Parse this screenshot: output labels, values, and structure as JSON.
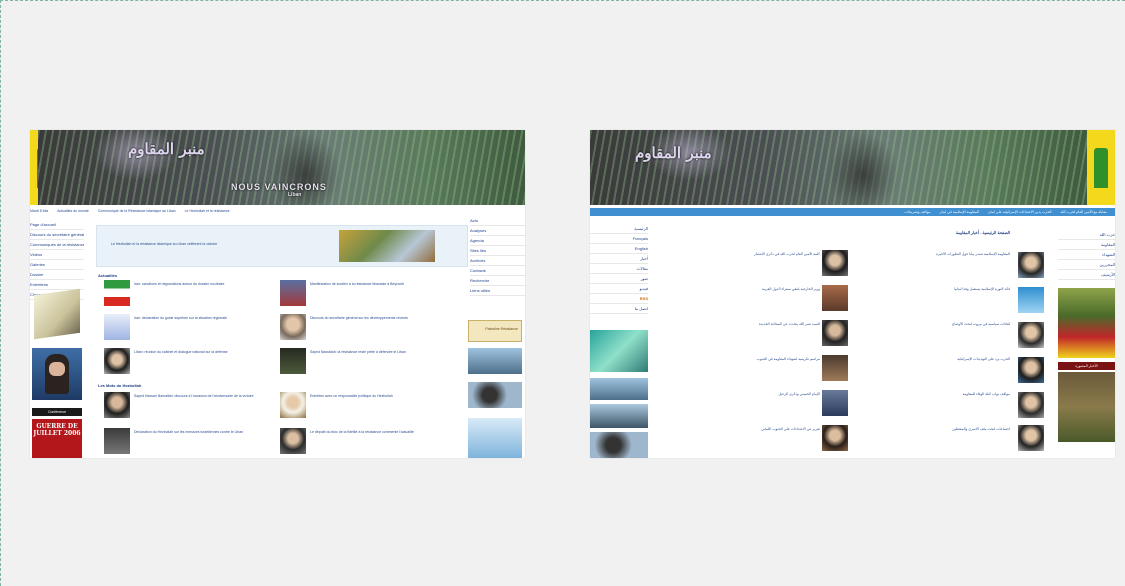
{
  "left_site": {
    "banner_title_ar": "منبر المقاوم",
    "banner_title_fr": "NOUS VAINCRONS",
    "banner_subtitle": "Liban",
    "link_bar": [
      "Mardi 8 Mai",
      "Actualités du monde",
      "Communiqué de la Résistance islamique au Liban",
      "Le Hezbollah et la résistance"
    ],
    "left_nav": [
      "Page d'accueil",
      "Discours du secrétaire général",
      "Communiqués de la résistance",
      "Vidéos",
      "Galeries",
      "Dossier",
      "Entretiens",
      "Chronologie"
    ],
    "left_ad_label": "Conférence",
    "left_box_caption": "GUERRE DE JUILLET 2006",
    "headline_text": "Le Hezbollah et la résistance islamique au Liban célèbrent la victoire",
    "section_actualites": "Actualités",
    "section_les_mots": "Les Mots du Hezbollah",
    "news_items": [
      "Iran: sanctions et négociations autour du dossier nucléaire",
      "Manifestation de soutien à la résistance libanaise à Beyrouth",
      "Iran: déclaration du guide suprême sur la situation régionale",
      "Discours du secrétaire général sur les développements récents",
      "Liban: réunion du cabinet et dialogue national sur la défense",
      "Sayed Nasrallah: la résistance reste prête à défendre le Liban"
    ],
    "mots_items": [
      "Sayed Hassan Nasrallah: discours à l'occasion de l'anniversaire de la victoire",
      "Entretien avec un responsable politique du Hezbollah",
      "Déclaration du Hezbollah sur les menaces israéliennes contre le Liban",
      "Le député du bloc de la fidélité à la résistance commente l'actualité"
    ],
    "right_nav": [
      "Actu",
      "Analyses",
      "Agenda",
      "Sites liés",
      "Archives",
      "Contacts",
      "Recherche",
      "Liens utiles"
    ],
    "right_ad_label": "Palestine Résistance"
  },
  "right_site": {
    "banner_title_ar": "منبر المقاوم",
    "link_bar": [
      "مقابلة مع الأمين العام لحزب الله",
      "الحزب يدين الاعتداءات الإسرائيلية على لبنان",
      "المقاومة الإسلامية في لبنان",
      "مواقف وتصريحات"
    ],
    "section_title": "الصفحة الرئيسية - أخبار المقاومة",
    "left_nav": [
      "الرئيسية",
      "Français",
      "English",
      "أخبار",
      "مقالات",
      "صور",
      "فيديو",
      "RSS",
      "اتصل بنا"
    ],
    "news_items": [
      "كلمة الأمين العام لحزب الله في ذكرى الانتصار",
      "المقاومة الإسلامية تصدر بيانا حول التطورات الأخيرة",
      "وزير الخارجية يلتقي سفراء الدول العربية",
      "قائد الثورة الإسلامية يستقبل وفدا لبنانيا",
      "السيد نصر الله يتحدث عن المعادلة الجديدة",
      "لقاءات سياسية في بيروت لبحث الأوضاع",
      "مراسم تكريمية لشهداء المقاومة في الجنوب",
      "الحزب يرد على التهديدات الإسرائيلية",
      "الإمام الخميني وذكرى الرحيل",
      "مواقف نواب كتلة الوفاء للمقاومة",
      "تقرير عن الاعتداءات على الجنوب اللبناني",
      "اجتماعات لبحث ملف الأسرى والمعتقلين"
    ],
    "right_nav": [
      "حزب الله",
      "المقاومة",
      "الشهداء",
      "المحررين",
      "الأرشيف"
    ],
    "right_ad_label": "الأخبار المصورة"
  }
}
